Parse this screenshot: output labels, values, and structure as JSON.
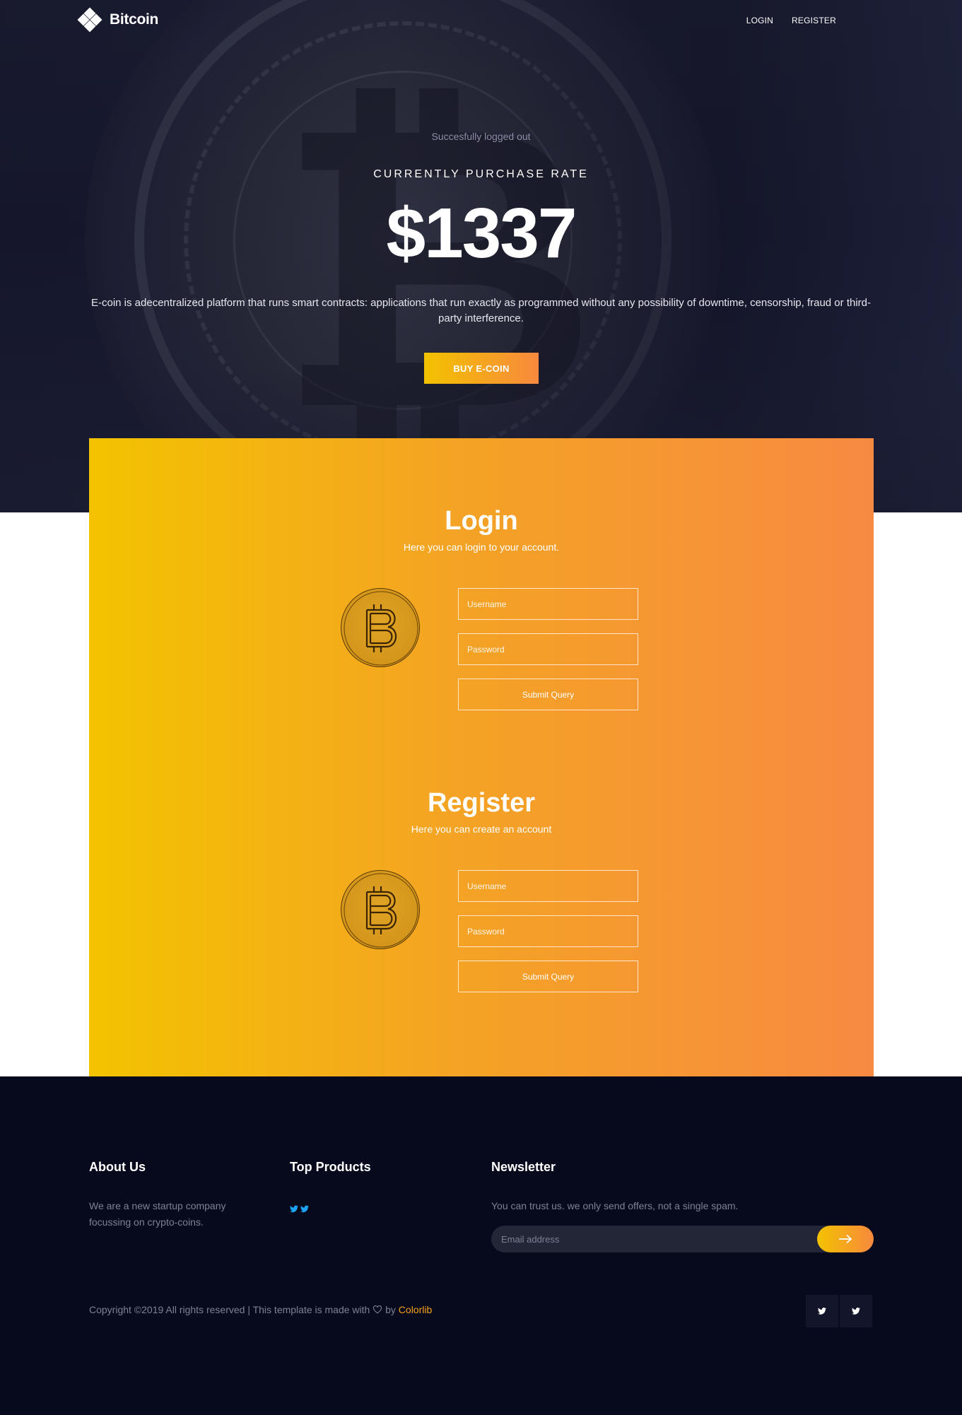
{
  "header": {
    "brand": "Bitcoin",
    "nav": [
      {
        "label": "LOGIN"
      },
      {
        "label": "REGISTER"
      }
    ]
  },
  "hero": {
    "status": "Succesfully logged out",
    "label": "CURRENTLY PURCHASE RATE",
    "price": "$1337",
    "description": "E-coin is adecentralized platform that runs smart contracts: applications that run exactly as programmed without any possibility of downtime, censorship, fraud or third-party interference.",
    "buy_button": "BUY E-COIN"
  },
  "login": {
    "title": "Login",
    "subtitle": "Here you can login to your account.",
    "username_placeholder": "Username",
    "password_placeholder": "Password",
    "submit_label": "Submit Query"
  },
  "register": {
    "title": "Register",
    "subtitle": "Here you can create an account",
    "username_placeholder": "Username",
    "password_placeholder": "Password",
    "submit_label": "Submit Query"
  },
  "footer": {
    "about_title": "About Us",
    "about_text": "We are a new startup company focussing on crypto-coins.",
    "products_title": "Top Products",
    "newsletter_title": "Newsletter",
    "newsletter_text": "You can trust us. we only send offers, not a single spam.",
    "email_placeholder": "Email address",
    "copyright_prefix": "Copyright ©2019 All rights reserved | This template is made with",
    "copyright_by": "by",
    "copyright_brand": "Colorlib"
  },
  "colors": {
    "accent_start": "#f3c200",
    "accent_end": "#f7893e",
    "hero_bg": "#1b1d33",
    "footer_bg": "#070a1c",
    "twitter": "#1da1f2"
  },
  "icons": [
    "logo-icon",
    "bitcoin-coin-icon",
    "twitter-icon",
    "arrow-right-icon",
    "heart-icon"
  ]
}
